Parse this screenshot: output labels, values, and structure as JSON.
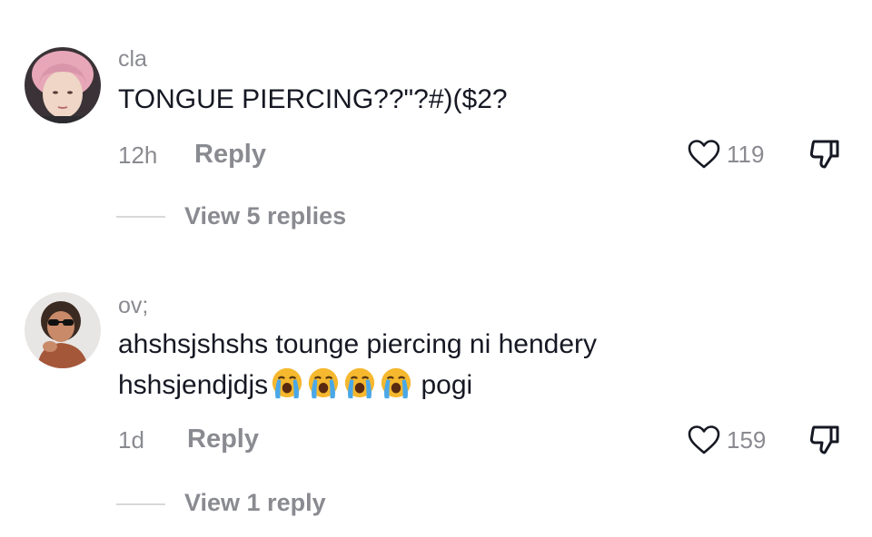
{
  "comments": [
    {
      "username": "cla",
      "text": "TONGUE PIERCING??\"?#)($2?",
      "time": "12h",
      "reply_label": "Reply",
      "likes": "119",
      "view_replies": "View 5 replies",
      "avatar_icon": "avatar-pink-hair"
    },
    {
      "username": "ov;",
      "text_line1": "ahshsjshshs tounge piercing ni hendery",
      "text_line2_prefix": "hshsjendjdjs",
      "text_line2_suffix": " pogi",
      "emojis": [
        "loudly-crying-face",
        "loudly-crying-face",
        "loudly-crying-face",
        "loudly-crying-face"
      ],
      "time": "1d",
      "reply_label": "Reply",
      "likes": "159",
      "view_replies": "View 1 reply",
      "avatar_icon": "avatar-sunglasses"
    }
  ],
  "colors": {
    "primary_text": "#161823",
    "secondary_text": "#8a8b91",
    "divider": "#d8d8da",
    "emoji_face": "#f5b82e",
    "emoji_tears": "#4aa8e8"
  }
}
